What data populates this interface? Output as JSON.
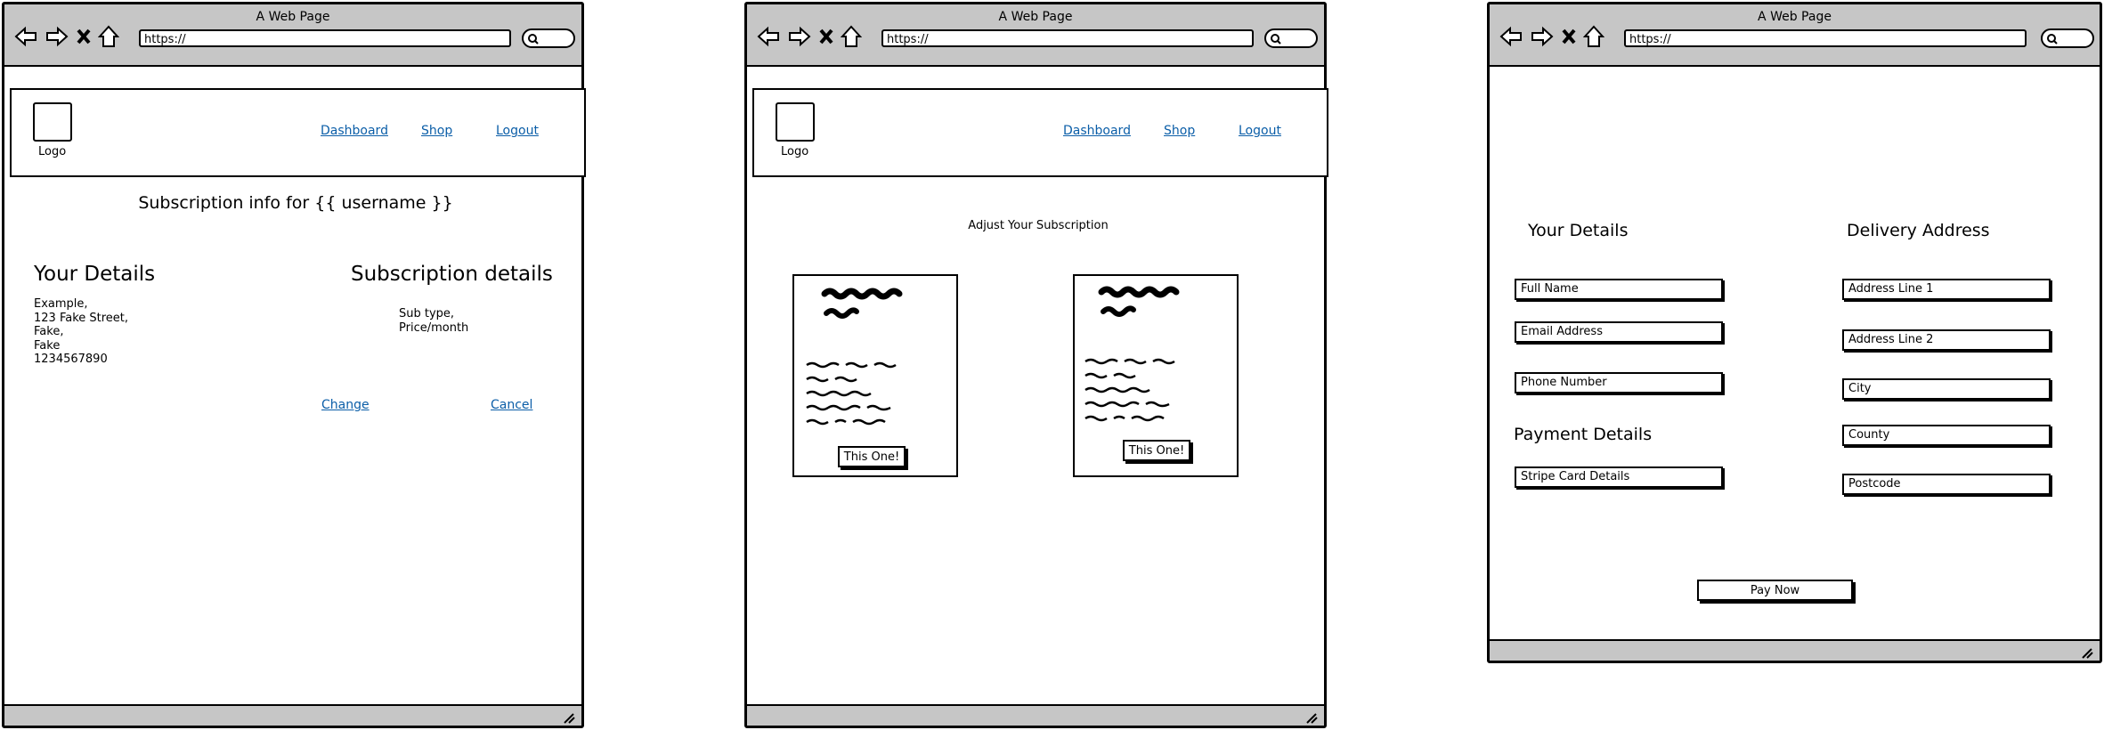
{
  "browser": {
    "title": "A Web Page",
    "url": "https://"
  },
  "header": {
    "logo_label": "Logo",
    "nav": [
      "Dashboard",
      "Shop",
      "Logout"
    ]
  },
  "wireframe1": {
    "heading": "Subscription info for {{ username }}",
    "your_details": {
      "title": "Your Details",
      "lines": [
        "Example,",
        "123 Fake Street,",
        "Fake,",
        "Fake",
        "1234567890"
      ]
    },
    "subscription_details": {
      "title": "Subscription details",
      "lines": [
        "Sub type,",
        "Price/month"
      ]
    },
    "change_link": "Change",
    "cancel_link": "Cancel"
  },
  "wireframe2": {
    "heading": "Adjust Your Subscription",
    "cards": [
      {
        "button": "This One!"
      },
      {
        "button": "This One!"
      }
    ]
  },
  "wireframe3": {
    "your_details_title": "Your Details",
    "delivery_title": "Delivery Address",
    "payment_title": "Payment Details",
    "left_fields": [
      "Full Name",
      "Email Address",
      "Phone Number"
    ],
    "payment_field": "Stripe Card Details",
    "right_fields": [
      "Address Line 1",
      "Address Line 2",
      "City",
      "County",
      "Postcode"
    ],
    "pay_button": "Pay Now"
  }
}
